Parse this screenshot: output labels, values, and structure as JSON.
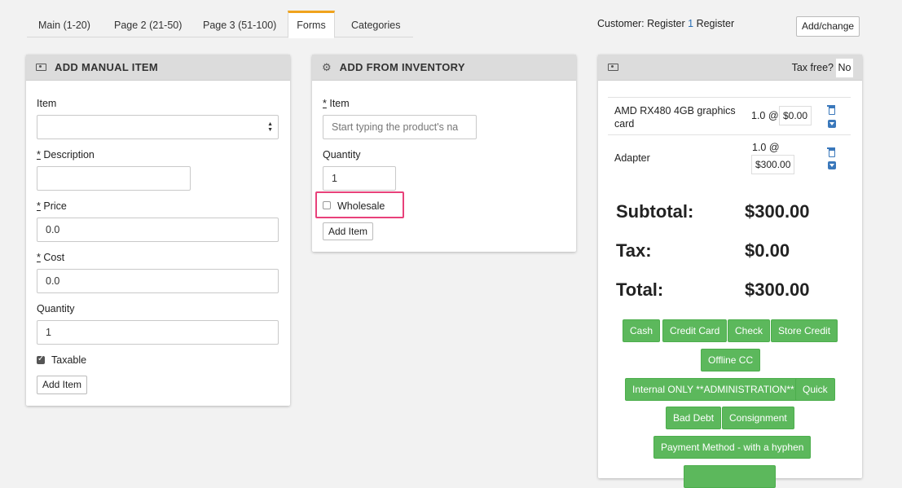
{
  "tabs": [
    {
      "label": "Main (1-20)"
    },
    {
      "label": "Page 2 (21-50)"
    },
    {
      "label": "Page 3 (51-100)"
    },
    {
      "label": "Forms",
      "active": true
    },
    {
      "label": "Categories"
    }
  ],
  "customer": {
    "prefix": "Customer: Register ",
    "number": "1",
    "suffix": " Register",
    "button_label": "Add/change"
  },
  "manual_item": {
    "title": "ADD MANUAL ITEM",
    "item_label": "Item",
    "item_value": "",
    "description_label": "Description",
    "description_value": "",
    "price_label": "Price",
    "price_value": "0.0",
    "cost_label": "Cost",
    "cost_value": "0.0",
    "quantity_label": "Quantity",
    "quantity_value": "1",
    "taxable_label": "Taxable",
    "taxable_checked": true,
    "add_button": "Add Item",
    "required_mark": "*"
  },
  "inventory": {
    "title": "ADD FROM INVENTORY",
    "item_label": "Item",
    "item_placeholder": "Start typing the product's na",
    "quantity_label": "Quantity",
    "quantity_value": "1",
    "wholesale_label": "Wholesale",
    "wholesale_checked": false,
    "add_button": "Add Item",
    "required_mark": "*"
  },
  "cart": {
    "tax_free_label": "Tax free?",
    "tax_free_value": "No",
    "items": [
      {
        "name": "AMD RX480 4GB graphics card",
        "qty": "1.0 @",
        "price": "$0.00"
      },
      {
        "name": "Adapter",
        "qty": "1.0 @",
        "price": "$300.00"
      }
    ],
    "subtotal_label": "Subtotal:",
    "subtotal_value": "$300.00",
    "tax_label": "Tax:",
    "tax_value": "$0.00",
    "total_label": "Total:",
    "total_value": "$300.00",
    "payment_methods": [
      "Cash",
      "Credit Card",
      "Check",
      "Store Credit",
      "Offline CC",
      "Internal ONLY **ADMINISTRATION**",
      "Quick",
      "Bad Debt",
      "Consignment",
      "Payment Method - with a hyphen"
    ]
  },
  "colors": {
    "accent_tab": "#f0a31d",
    "pay_button": "#5cb85c",
    "highlight": "#e8417a",
    "icon_blue": "#3a78bb"
  }
}
